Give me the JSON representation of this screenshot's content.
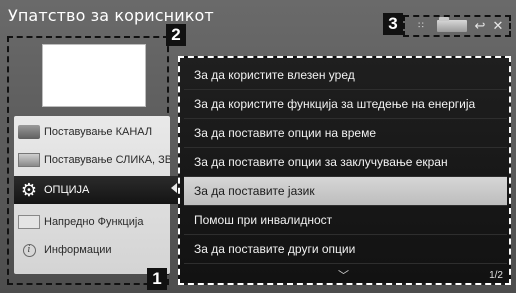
{
  "window": {
    "title": "Упатство за корисникот"
  },
  "callouts": {
    "left_panel": "1",
    "right_panel": "2",
    "controls": "3"
  },
  "controls": {
    "list_glyph": "∷",
    "back_glyph": "↩",
    "close_glyph": "✕"
  },
  "sidebar": {
    "items": [
      {
        "label": "Поставување КАНАЛ",
        "icon": "channel-icon"
      },
      {
        "label": "Поставување СЛИКА, ЗВУК",
        "icon": "picture-sound-icon"
      },
      {
        "label": "ОПЦИЈА",
        "icon": "gear-icon",
        "selected": true
      },
      {
        "label": "Напредно Функција",
        "icon": "advanced-icon"
      },
      {
        "label": "Информации",
        "icon": "info-icon"
      }
    ]
  },
  "options_list": {
    "items": [
      {
        "label": "За да користите влезен уред"
      },
      {
        "label": "За да користите функција за штедење на енергија"
      },
      {
        "label": "За да поставите опции на време"
      },
      {
        "label": "За да поставите опции за заклучување екран"
      },
      {
        "label": "За да поставите јазик",
        "selected": true
      },
      {
        "label": "Помош при инвалидност"
      },
      {
        "label": "За да поставите други опции"
      }
    ],
    "scroll_glyph": "﹀",
    "page_indicator": "1/2"
  }
}
